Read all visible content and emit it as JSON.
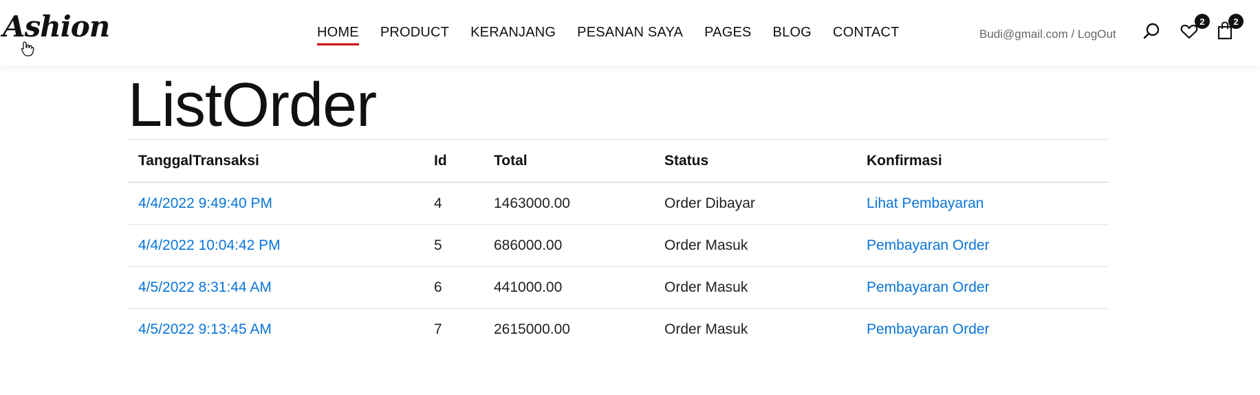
{
  "brand": {
    "logo": "Ashion"
  },
  "nav": {
    "items": [
      {
        "label": "HOME",
        "active": true
      },
      {
        "label": "PRODUCT"
      },
      {
        "label": "KERANJANG"
      },
      {
        "label": "PESANAN SAYA"
      },
      {
        "label": "PAGES"
      },
      {
        "label": "BLOG"
      },
      {
        "label": "CONTACT"
      }
    ]
  },
  "header": {
    "user_link": "Budi@gmail.com / LogOut",
    "icons": [
      "search-icon",
      "heart-icon",
      "shopping-bag-icon"
    ],
    "wishlist_count": "2",
    "cart_count": "2"
  },
  "page": {
    "title": "ListOrder"
  },
  "table": {
    "headers": [
      "TanggalTransaksi",
      "Id",
      "Total",
      "Status",
      "Konfirmasi"
    ],
    "rows": [
      {
        "date": "4/4/2022 9:49:40 PM",
        "id": "4",
        "total": "1463000.00",
        "status": "Order Dibayar",
        "action": "Lihat Pembayaran"
      },
      {
        "date": "4/4/2022 10:04:42 PM",
        "id": "5",
        "total": "686000.00",
        "status": "Order Masuk",
        "action": "Pembayaran Order"
      },
      {
        "date": "4/5/2022 8:31:44 AM",
        "id": "6",
        "total": "441000.00",
        "status": "Order Masuk",
        "action": "Pembayaran Order"
      },
      {
        "date": "4/5/2022 9:13:45 AM",
        "id": "7",
        "total": "2615000.00",
        "status": "Order Masuk",
        "action": "Pembayaran Order"
      }
    ]
  },
  "colors": {
    "link": "#0a74da",
    "active_underline": "#cc0000",
    "text": "#111111",
    "muted": "#666666"
  }
}
